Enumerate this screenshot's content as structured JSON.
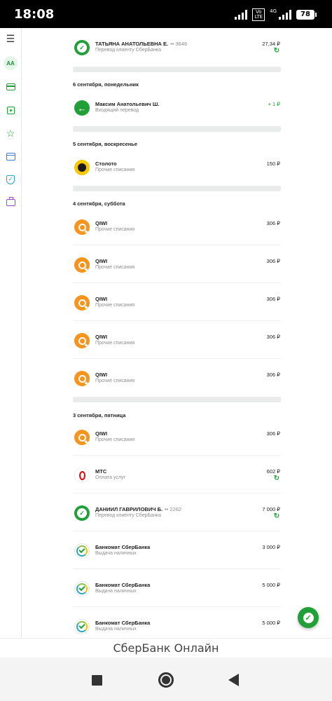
{
  "status_bar": {
    "time": "18:08",
    "volte_top": "Vo",
    "volte_bottom": "LTE",
    "network": "4G",
    "battery": "78"
  },
  "sidebar": {
    "menu_icon": "hamburger-icon",
    "avatar_initials": "АА",
    "items": [
      "card-icon",
      "deposit-icon",
      "star-icon",
      "window-icon",
      "shield-icon",
      "briefcase-icon"
    ]
  },
  "feed": {
    "top_row": {
      "name": "ТАТЬЯНА АНАТОЛЬЕВНА Е.",
      "card_mask": "•• 3646",
      "desc": "Перевод клиенту СберБанка",
      "amount": "27,34 ₽",
      "repeat_icon": "repeat-icon"
    },
    "day_6": {
      "header": "6 сентября, понедельник",
      "rows": [
        {
          "name": "Максим Анатольевич Ш.",
          "desc": "Входящий перевод",
          "amount": "+ 1 ₽"
        }
      ]
    },
    "day_5": {
      "header": "5 сентября, воскресенье",
      "rows": [
        {
          "name": "Столото",
          "desc": "Прочие списания",
          "amount": "150 ₽"
        }
      ]
    },
    "day_4": {
      "header": "4 сентября, суббота",
      "rows": [
        {
          "name": "QIWI",
          "desc": "Прочие списания",
          "amount": "306 ₽"
        },
        {
          "name": "QIWI",
          "desc": "Прочие списания",
          "amount": "306 ₽"
        },
        {
          "name": "QIWI",
          "desc": "Прочие списания",
          "amount": "306 ₽"
        },
        {
          "name": "QIWI",
          "desc": "Прочие списания",
          "amount": "306 ₽"
        },
        {
          "name": "QIWI",
          "desc": "Прочие списания",
          "amount": "306 ₽"
        }
      ]
    },
    "day_3": {
      "header": "3 сентября, пятница",
      "rows": [
        {
          "name": "QIWI",
          "desc": "Прочие списания",
          "amount": "306 ₽"
        },
        {
          "name": "МТС",
          "desc": "Оплата услуг",
          "amount": "602 ₽"
        },
        {
          "name": "ДАНИИЛ ГАВРИЛОВИЧ Б.",
          "card_mask": "•• 2262",
          "desc": "Перевод клиенту СберБанка",
          "amount": "7 000 ₽"
        },
        {
          "name": "Банкомат СберБанка",
          "desc": "Выдача наличных",
          "amount": "3 000 ₽"
        },
        {
          "name": "Банкомат СберБанка",
          "desc": "Выдача наличных",
          "amount": "5 000 ₽"
        },
        {
          "name": "Банкомат СберБанка",
          "desc": "Выдача наличных",
          "amount": "5 000 ₽"
        }
      ]
    }
  },
  "fab_icon": "sber-assistant-icon",
  "app_label": "СберБанк Онлайн",
  "nav_bar": [
    "recents-square-icon",
    "home-circle-icon",
    "back-triangle-icon"
  ],
  "colors": {
    "accent": "#21a038",
    "qiwi": "#f7941d",
    "mts": "#e30611",
    "stoloto": "#f5c800"
  }
}
